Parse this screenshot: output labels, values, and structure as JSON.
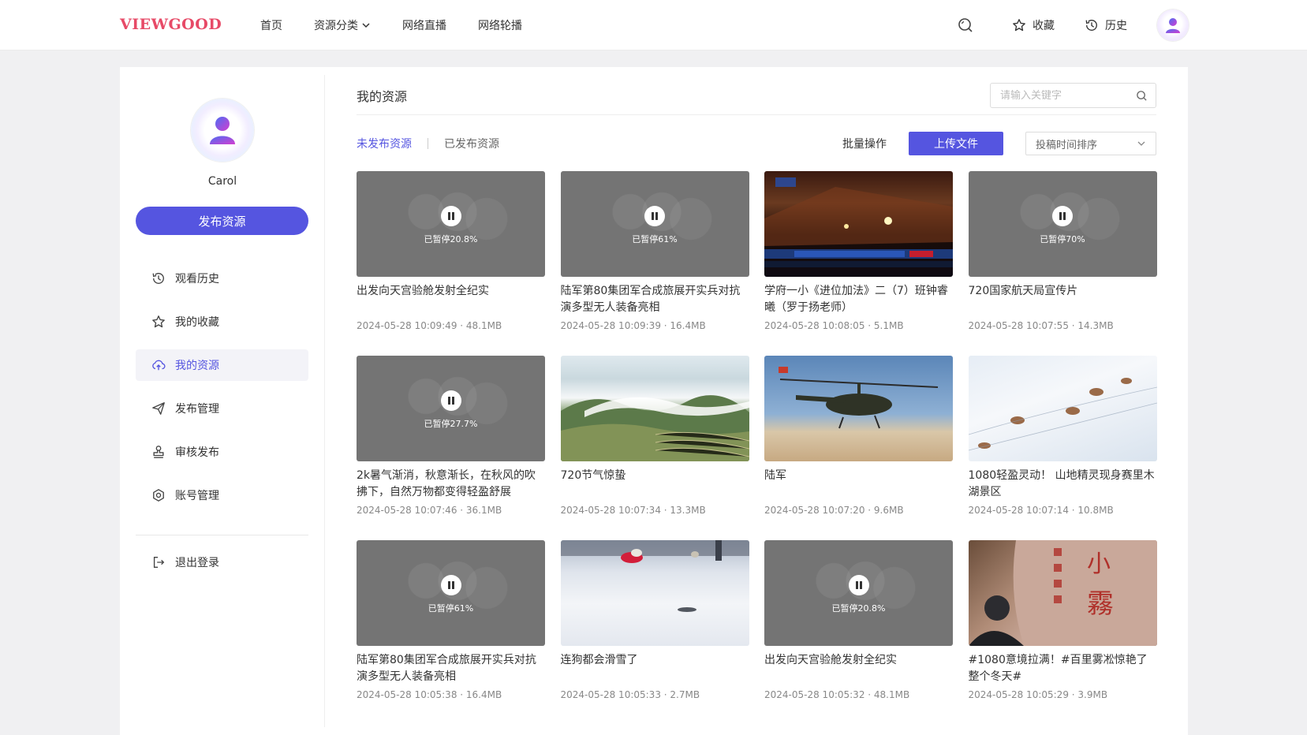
{
  "header": {
    "logo": "VIEWGOOD",
    "nav": [
      {
        "label": "首页"
      },
      {
        "label": "资源分类"
      },
      {
        "label": "网络直播"
      },
      {
        "label": "网络轮播"
      }
    ],
    "favorites_label": "收藏",
    "history_label": "历史"
  },
  "sidebar": {
    "username": "Carol",
    "publish_button": "发布资源",
    "menu": [
      {
        "label": "观看历史",
        "icon": "history-icon"
      },
      {
        "label": "我的收藏",
        "icon": "star-icon"
      },
      {
        "label": "我的资源",
        "icon": "cloud-upload-icon",
        "active": true
      },
      {
        "label": "发布管理",
        "icon": "send-icon"
      },
      {
        "label": "审核发布",
        "icon": "stamp-icon"
      },
      {
        "label": "账号管理",
        "icon": "account-settings-icon"
      }
    ],
    "logout_label": "退出登录"
  },
  "content": {
    "title": "我的资源",
    "search_placeholder": "请输入关键字",
    "tabs": [
      "未发布资源",
      "已发布资源"
    ],
    "batch_label": "批量操作",
    "upload_label": "上传文件",
    "sort_label": "投稿时间排序",
    "accent_color": "#5555e0",
    "items": [
      {
        "title": "出发向天宫验舱发射全纪实",
        "meta": "2024-05-28 10:09:49 · 48.1MB",
        "paused": "已暂停20.8%",
        "scene": "paused"
      },
      {
        "title": "陆军第80集团军合成旅展开实兵对抗演多型无人装备亮相",
        "meta": "2024-05-28 10:09:39 · 16.4MB",
        "paused": "已暂停61%",
        "scene": "paused"
      },
      {
        "title": "学府一小《进位加法》二（7）班钟睿曦（罗于扬老师）",
        "meta": "2024-05-28 10:08:05 · 5.1MB",
        "paused": "",
        "scene": "ceremony"
      },
      {
        "title": "720国家航天局宣传片",
        "meta": "2024-05-28 10:07:55 · 14.3MB",
        "paused": "已暂停70%",
        "scene": "paused"
      },
      {
        "title": "2k暑气渐消，秋意渐长，在秋风的吹拂下，自然万物都变得轻盈舒展",
        "meta": "2024-05-28 10:07:46 · 36.1MB",
        "paused": "已暂停27.7%",
        "scene": "paused"
      },
      {
        "title": "720节气惊蛰",
        "meta": "2024-05-28 10:07:34 · 13.3MB",
        "paused": "",
        "scene": "mountain"
      },
      {
        "title": "陆军",
        "meta": "2024-05-28 10:07:20 · 9.6MB",
        "paused": "",
        "scene": "heli"
      },
      {
        "title": "1080轻盈灵动！ 山地精灵现身赛里木湖景区",
        "meta": "2024-05-28 10:07:14 · 10.8MB",
        "paused": "",
        "scene": "snowgoats"
      },
      {
        "title": "陆军第80集团军合成旅展开实兵对抗演多型无人装备亮相",
        "meta": "2024-05-28 10:05:38 · 16.4MB",
        "paused": "已暂停61%",
        "scene": "paused"
      },
      {
        "title": "连狗都会滑雪了",
        "meta": "2024-05-28 10:05:33 · 2.7MB",
        "paused": "",
        "scene": "snowslide"
      },
      {
        "title": "出发向天宫验舱发射全纪实",
        "meta": "2024-05-28 10:05:32 · 48.1MB",
        "paused": "已暂停20.8%",
        "scene": "paused"
      },
      {
        "title": "#1080意境拉满！#百里雾凇惊艳了整个冬天#",
        "meta": "2024-05-28 10:05:29 · 3.9MB",
        "paused": "",
        "scene": "rock"
      }
    ]
  }
}
